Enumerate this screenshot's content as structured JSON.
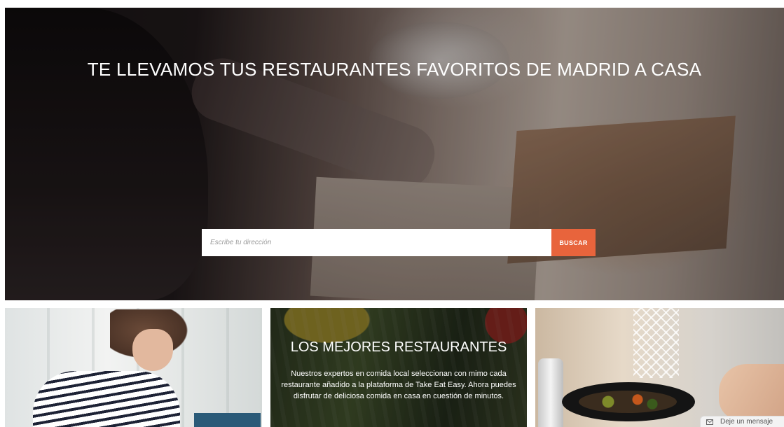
{
  "hero": {
    "title": "TE LLEVAMOS TUS RESTAURANTES FAVORITOS DE MADRID A CASA",
    "search": {
      "placeholder": "Escribe tu dirección",
      "value": "",
      "button_label": "BUSCAR"
    }
  },
  "features": [
    {
      "image": "chef-woman-photo"
    },
    {
      "title": "LOS MEJORES RESTAURANTES",
      "text": "Nuestros expertos en comida local seleccionan con mimo cada restaurante añadido a la plataforma de Take Eat Easy. Ahora puedes disfrutar de deliciosa comida en casa en cuestión de minutos."
    },
    {
      "image": "cooking-pan-photo"
    }
  ],
  "chat": {
    "label": "Deje un mensaje",
    "icon": "envelope-icon"
  },
  "colors": {
    "accent": "#e8643c"
  }
}
